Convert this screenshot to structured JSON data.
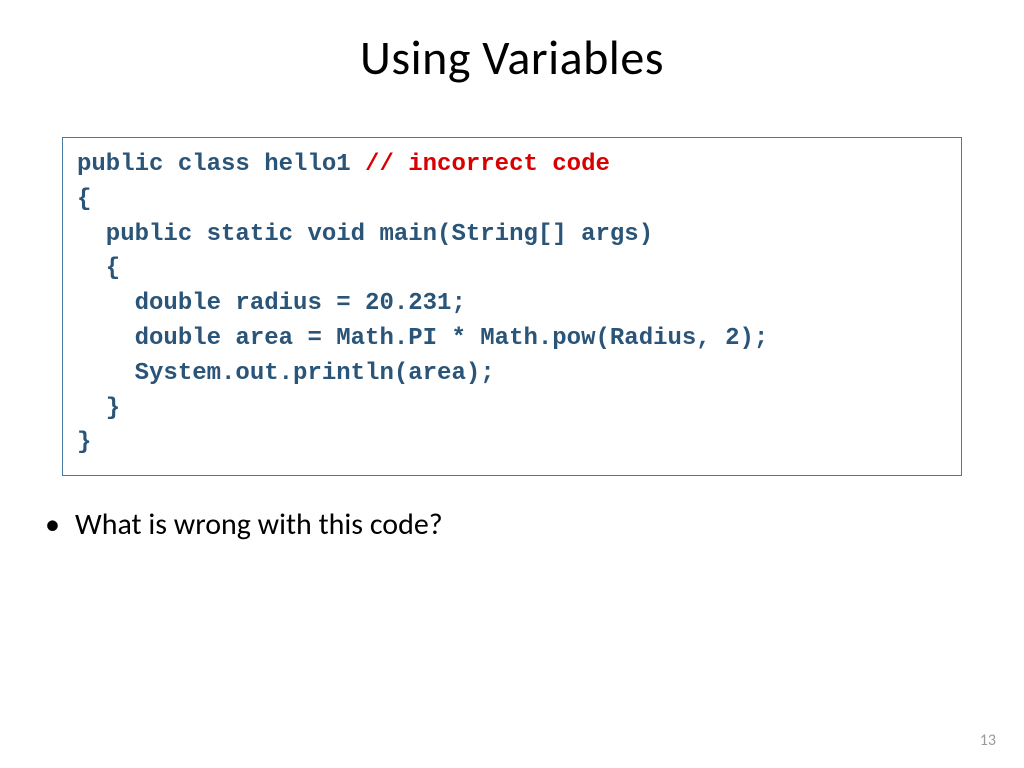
{
  "title": "Using Variables",
  "code": {
    "line1a": "public class hello1 ",
    "line1b": "// incorrect code",
    "line2": "{",
    "line3": "  public static void main(String[] args)",
    "line4": "  {",
    "line5": "    double radius = 20.231;",
    "line6": "    double area = Math.PI * Math.pow(Radius, 2);",
    "line7": "    System.out.println(area);",
    "line8": "  }",
    "line9": "}"
  },
  "bullet1": "What is wrong with this code?",
  "page_number": "13"
}
